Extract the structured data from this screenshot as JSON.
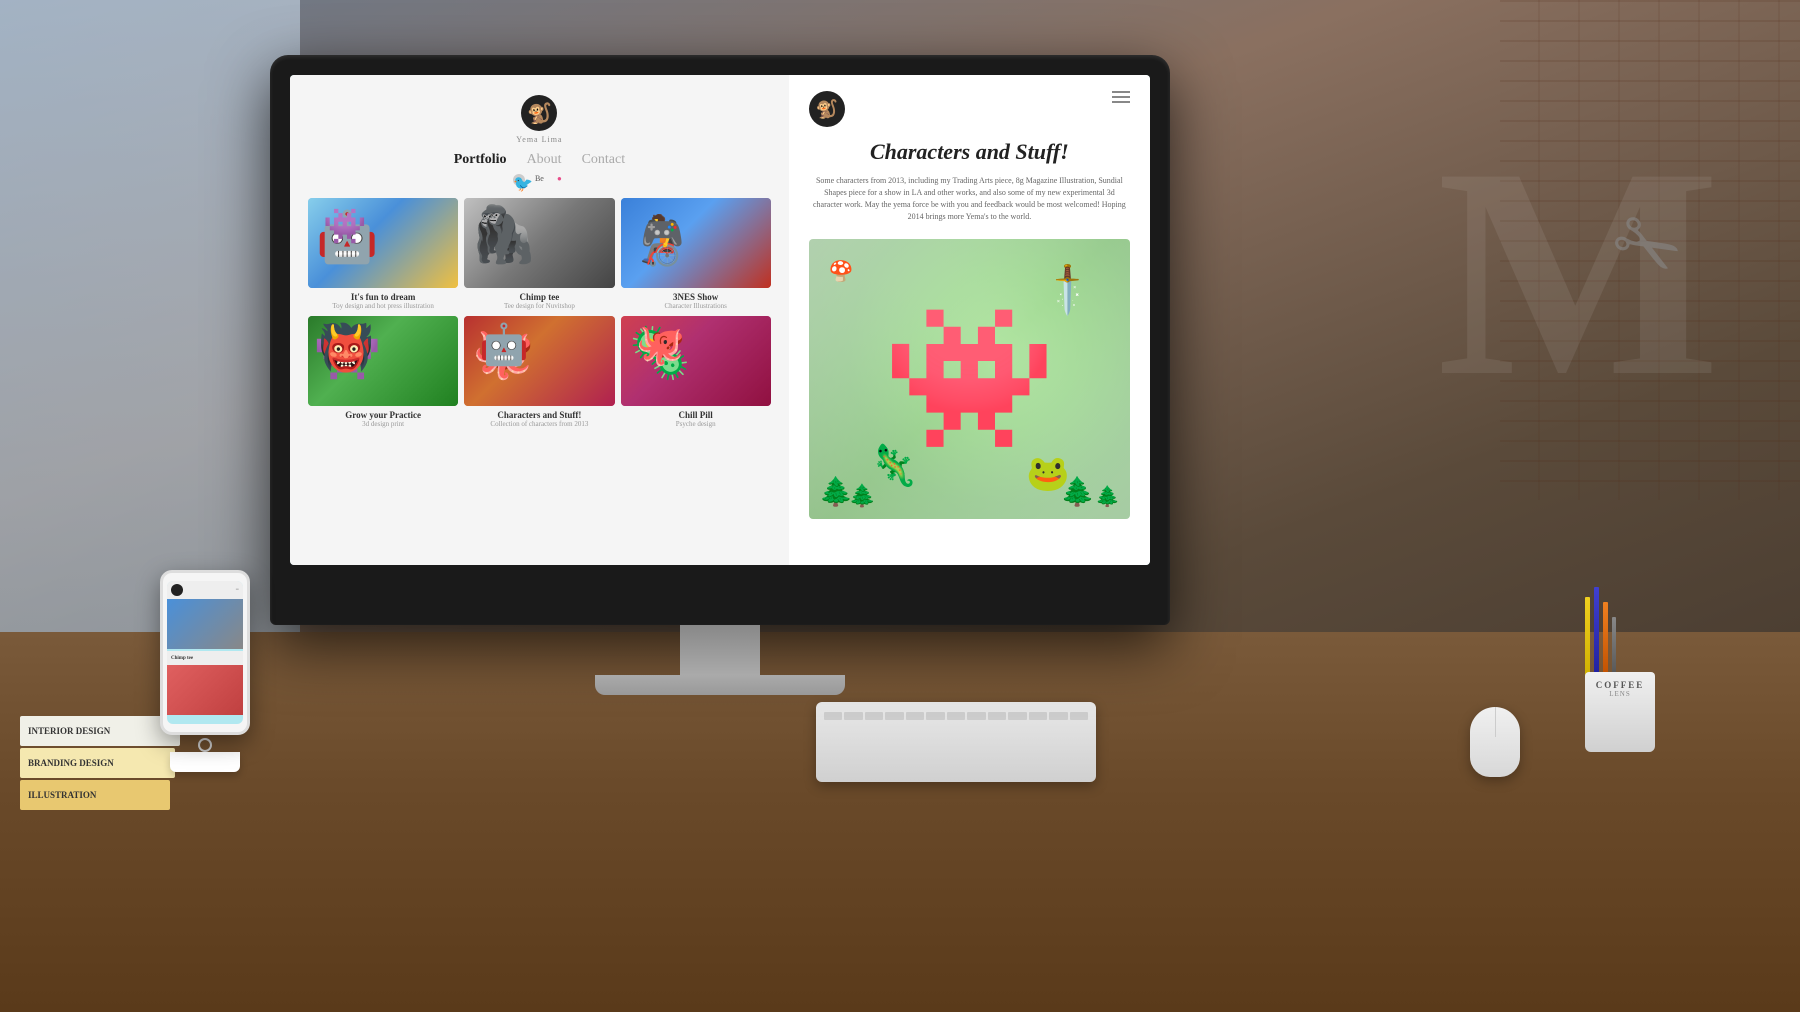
{
  "background": {
    "color": "#4a5a6b"
  },
  "monitor": {
    "screen": {
      "portfolio_panel": {
        "logo": {
          "emoji": "🐒",
          "tagline": "Yema Lima"
        },
        "nav": {
          "items": [
            {
              "label": "Portfolio",
              "active": true
            },
            {
              "label": "About",
              "active": false
            },
            {
              "label": "Contact",
              "active": false
            }
          ]
        },
        "portfolio_items": [
          {
            "title": "It's fun to dream",
            "subtitle": "Toy design and hot press illustration",
            "thumb_class": "thumb-dream"
          },
          {
            "title": "Chimp tee",
            "subtitle": "Tee design for Nuvitshop",
            "thumb_class": "thumb-chimp"
          },
          {
            "title": "3NES Show",
            "subtitle": "Character Illustrations",
            "thumb_class": "thumb-3nes"
          },
          {
            "title": "Grow your Practice",
            "subtitle": "3d design print",
            "thumb_class": "thumb-practice"
          },
          {
            "title": "Characters and Stuff!",
            "subtitle": "Collection of characters from 2013",
            "thumb_class": "thumb-characters"
          },
          {
            "title": "Chill Pill",
            "subtitle": "Psyche design",
            "thumb_class": "thumb-chill"
          }
        ]
      },
      "detail_panel": {
        "title": "Characters and Stuff!",
        "description": "Some characters from 2013, including my Trading Arts piece, 8g Magazine Illustration, Sundial Shapes piece for a show in LA and other works, and also some of my new experimental 3d character work. May the yema force be with you and feedback would be most welcomed! Hoping 2014 brings more Yema's to the world.",
        "artwork_emoji": "🦎"
      }
    }
  },
  "phone": {
    "visible": true
  },
  "books": [
    {
      "title": "INTERIOR design",
      "class": "book-1"
    },
    {
      "title": "BRANDING design",
      "class": "book-2"
    },
    {
      "title": "ILLUSTRATION",
      "class": "book-3"
    }
  ],
  "coffee_mug": {
    "label": "COFFEE"
  }
}
